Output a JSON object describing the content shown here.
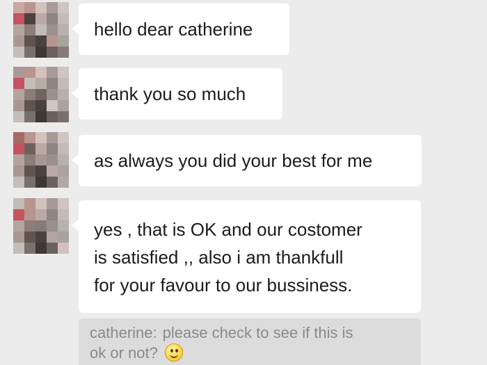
{
  "messages": [
    {
      "text_lines": [
        "hello dear catherine"
      ],
      "avatar": "blurred-avatar"
    },
    {
      "text_lines": [
        "thank you so much"
      ],
      "avatar": "blurred-avatar"
    },
    {
      "text_lines": [
        "as always you did your best for me"
      ],
      "avatar": "blurred-avatar"
    },
    {
      "text_lines": [
        "yes , that is OK and our costomer",
        "is satisfied ,, also i am thankfull",
        "for your favour to our bussiness."
      ],
      "avatar": "blurred-avatar"
    }
  ],
  "quote": {
    "name": "catherine:",
    "text_line1": "please check to see if this is",
    "text_line2": "ok or not?",
    "emoji": "smiling-face-emoji"
  },
  "colors": {
    "background": "#ececec",
    "bubble": "#ffffff",
    "quote_background": "#dcdcdc",
    "quote_text": "#8a8a8a"
  }
}
